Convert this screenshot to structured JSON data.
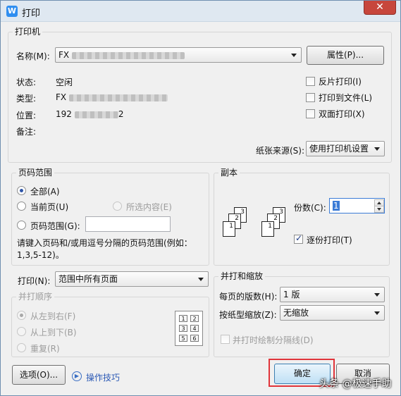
{
  "window": {
    "title": "打印",
    "app_icon_letter": "W",
    "close_symbol": "✕"
  },
  "printer": {
    "group_title": "打印机",
    "name_label": "名称(M):",
    "name_value": "FX",
    "properties_button": "属性(P)...",
    "status_label": "状态:",
    "status_value": "空闲",
    "type_label": "类型:",
    "type_value": "FX",
    "location_label": "位置:",
    "location_value_prefix": "192",
    "location_value_suffix": "2",
    "comment_label": "备注:",
    "reverse_print": "反片打印(I)",
    "print_to_file": "打印到文件(L)",
    "duplex_print": "双面打印(X)",
    "paper_source_label": "纸张来源(S):",
    "paper_source_value": "使用打印机设置"
  },
  "page_range": {
    "group_title": "页码范围",
    "all": "全部(A)",
    "current_page": "当前页(U)",
    "selection": "所选内容(E)",
    "pages": "页码范围(G):",
    "hint": "请键入页码和/或用逗号分隔的页码范围(例如：1,3,5-12)。"
  },
  "copies": {
    "group_title": "副本",
    "count_label": "份数(C):",
    "count_value": "1",
    "collate": "逐份打印(T)",
    "page_labels": [
      "1",
      "2",
      "3"
    ]
  },
  "print": {
    "label": "打印(N):",
    "value": "范围中所有页面"
  },
  "order": {
    "group_title": "并打顺序",
    "left_to_right": "从左到右(F)",
    "top_to_bottom": "从上到下(B)",
    "repeat": "重复(R)",
    "grid_labels": [
      "1",
      "2",
      "3",
      "4",
      "5",
      "6"
    ]
  },
  "zoom": {
    "group_title": "并打和缩放",
    "pages_per_sheet_label": "每页的版数(H):",
    "pages_per_sheet_value": "1 版",
    "scale_label": "按纸型缩放(Z):",
    "scale_value": "无缩放",
    "draw_separator": "并打时绘制分隔线(D)"
  },
  "footer": {
    "options_button": "选项(O)...",
    "tips_link": "操作技巧",
    "ok_button": "确定",
    "cancel_button": "取消",
    "watermark": "头条 @极速手助"
  },
  "colors": {
    "dialog_bg": "#f0f0f0",
    "close_red": "#c7463c",
    "highlight_red": "#e0343a",
    "link_blue": "#2b59b5"
  }
}
